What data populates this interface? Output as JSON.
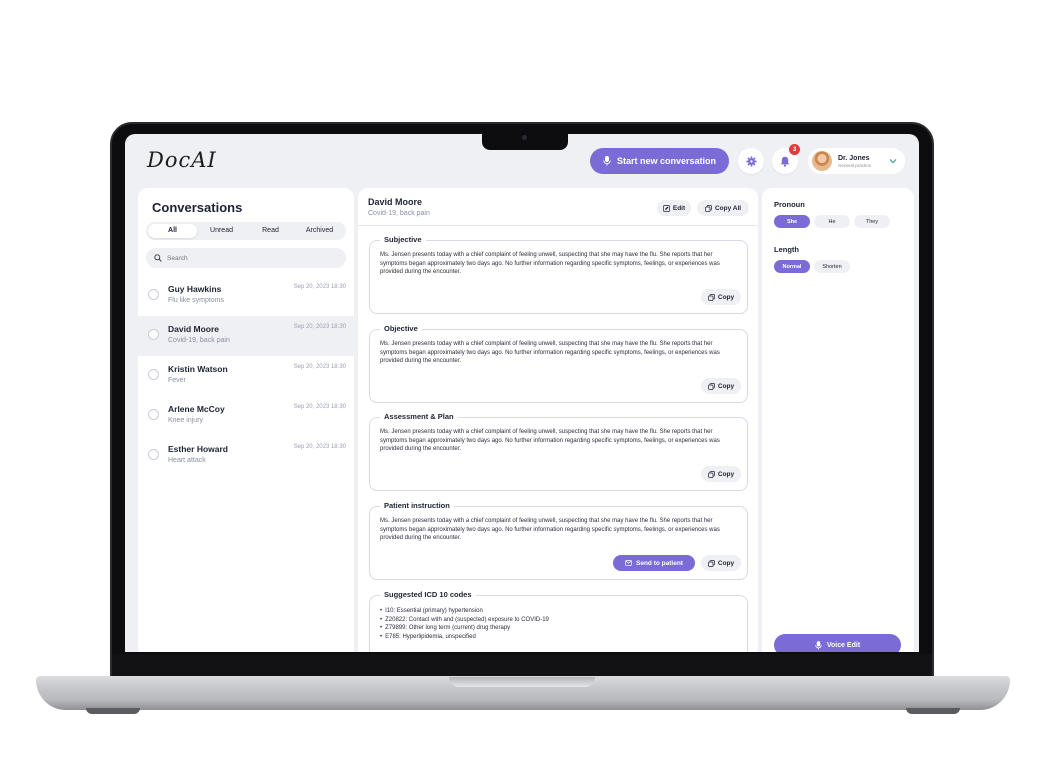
{
  "app": {
    "logo": "DocAI"
  },
  "topbar": {
    "new_conversation_label": "Start new conversation",
    "notification_count": "3",
    "user": {
      "name": "Dr. Jones",
      "role": "General practice"
    }
  },
  "conversations": {
    "title": "Conversations",
    "filters": [
      "All",
      "Unread",
      "Read",
      "Archived"
    ],
    "active_filter": "All",
    "search_placeholder": "Search",
    "items": [
      {
        "name": "Guy Hawkins",
        "subtitle": "Flu like symptoms",
        "date": "Sep 20, 2023 18:30"
      },
      {
        "name": "David Moore",
        "subtitle": "Covid-19, back pain",
        "date": "Sep 20, 2023 18:30"
      },
      {
        "name": "Kristin Watson",
        "subtitle": "Fever",
        "date": "Sep 20, 2023 18:30"
      },
      {
        "name": "Arlene McCoy",
        "subtitle": "Knee injury",
        "date": "Sep 20, 2023 18:30"
      },
      {
        "name": "Esther Howard",
        "subtitle": "Heart attack",
        "date": "Sep 20, 2023 18:30"
      }
    ]
  },
  "note": {
    "patient_name": "David Moore",
    "patient_subtitle": "Covid-19, back pain",
    "edit_label": "Edit",
    "copy_all_label": "Copy All",
    "copy_label": "Copy",
    "send_to_patient_label": "Send to patient",
    "sections": [
      {
        "title": "Subjective",
        "body": "Ms. Jensen presents today with a chief complaint of feeling unwell, suspecting that she may have the flu. She reports that her symptoms began approximately two days ago. No further information regarding specific symptoms, feelings, or experiences was provided during the encounter."
      },
      {
        "title": "Objective",
        "body": "Ms. Jensen presents today with a chief complaint of feeling unwell, suspecting that she may have the flu. She reports that her symptoms began approximately two days ago. No further information regarding specific symptoms, feelings, or experiences was provided during the encounter."
      },
      {
        "title": "Assessment & Plan",
        "body": "Ms. Jensen presents today with a chief complaint of feeling unwell, suspecting that she may have the flu. She reports that her symptoms began approximately two days ago. No further information regarding specific symptoms, feelings, or experiences was provided during the encounter."
      },
      {
        "title": "Patient instruction",
        "body": "Ms. Jensen presents today with a chief complaint of feeling unwell, suspecting that she may have the flu. She reports that her symptoms began approximately two days ago. No further information regarding specific symptoms, feelings, or experiences was provided during the encounter."
      }
    ],
    "icd": {
      "title": "Suggested ICD 10 codes",
      "codes": [
        "I10: Essential (primary) hypertension",
        "Z20822: Contact with and (suspected) exposure to COVID-19",
        "Z79899: Other long term (current) drug therapy",
        "E785: Hyperlipidemia, unspecified"
      ]
    }
  },
  "options": {
    "pronoun_label": "Pronoun",
    "pronouns": [
      "She",
      "He",
      "They"
    ],
    "active_pronoun": "She",
    "length_label": "Length",
    "lengths": [
      "Normal",
      "Shorten"
    ],
    "active_length": "Normal",
    "voice_edit_label": "Voice Edit"
  },
  "colors": {
    "accent": "#7a6bd6",
    "badge": "#e23a3a",
    "background": "#eef0f4"
  },
  "icons": [
    "mic-icon",
    "gear-icon",
    "bell-icon",
    "chevron-down-icon",
    "search-icon",
    "edit-icon",
    "copy-icon",
    "send-icon"
  ]
}
